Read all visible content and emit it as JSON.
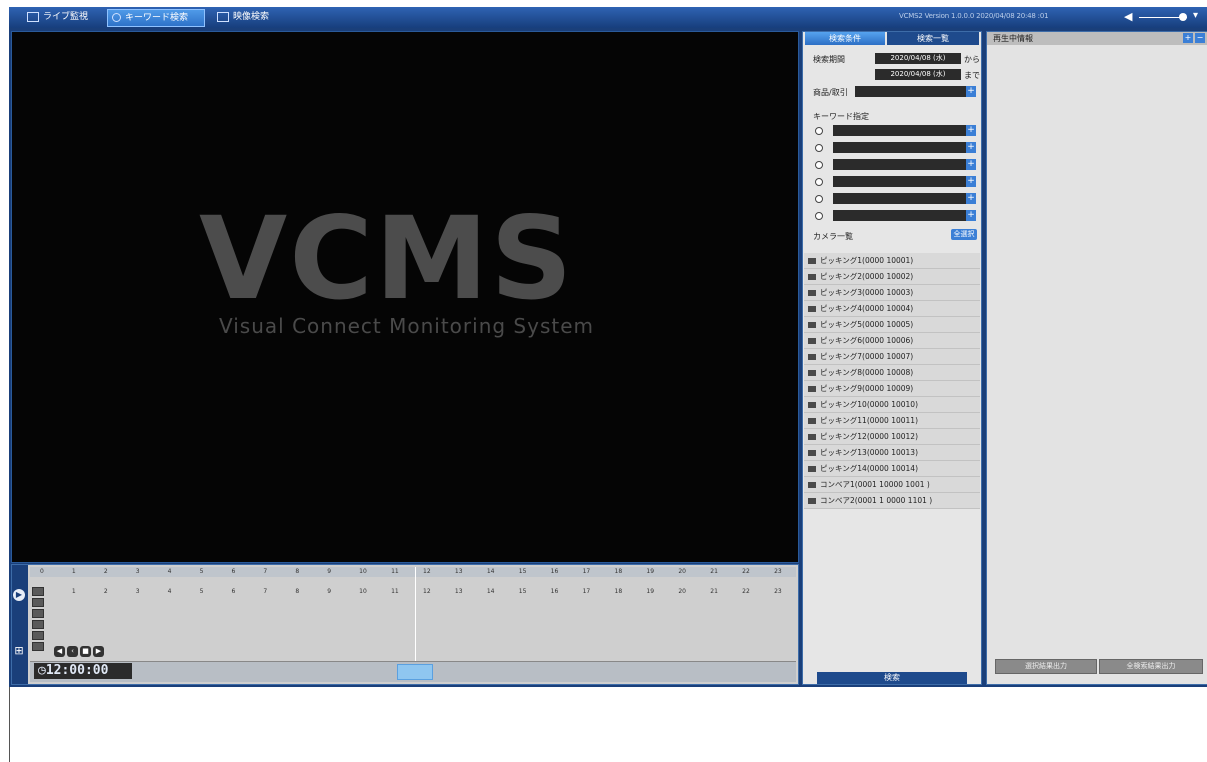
{
  "topbar": {
    "tabs": [
      {
        "label": "ライブ監視"
      },
      {
        "label": "キーワード検索"
      },
      {
        "label": "映像検索"
      }
    ],
    "version": "VCMS2 Version 1.0.0.0  2020/04/08  20:48 :01"
  },
  "video": {
    "logo": "VCMS",
    "subtitle": "Visual Connect Monitoring System"
  },
  "timeline": {
    "ruler_labels": [
      "0",
      "1",
      "2",
      "3",
      "4",
      "5",
      "6",
      "7",
      "8",
      "9",
      "10",
      "11",
      "12",
      "13",
      "14",
      "15",
      "16",
      "17",
      "18",
      "19",
      "20",
      "21",
      "22",
      "23"
    ],
    "time": "12:00:00"
  },
  "search": {
    "tabs": [
      "検索条件",
      "検索一覧"
    ],
    "period_label": "検索期間",
    "from_date": "2020/04/08 (水)",
    "to_date": "2020/04/08 (水)",
    "from_suffix": "から",
    "to_suffix": "まで",
    "product_label": "商品/取引",
    "keyword_label": "キーワード指定",
    "camera_list_label": "カメラ一覧",
    "all_button": "全選択",
    "cameras": [
      "ピッキング1(0000 10001)",
      "ピッキング2(0000 10002)",
      "ピッキング3(0000 10003)",
      "ピッキング4(0000 10004)",
      "ピッキング5(0000 10005)",
      "ピッキング6(0000 10006)",
      "ピッキング7(0000 10007)",
      "ピッキング8(0000 10008)",
      "ピッキング9(0000 10009)",
      "ピッキング10(0000 10010)",
      "ピッキング11(0000 10011)",
      "ピッキング12(0000 10012)",
      "ピッキング13(0000 10013)",
      "ピッキング14(0000 10014)",
      "コンベア1(0001 10000 1001 )",
      "コンベア2(0001 1 0000 1101 )"
    ],
    "search_button": "検索"
  },
  "playback": {
    "title": "再生中情報",
    "btn1": "選択結果出力",
    "btn2": "全検索結果出力"
  }
}
